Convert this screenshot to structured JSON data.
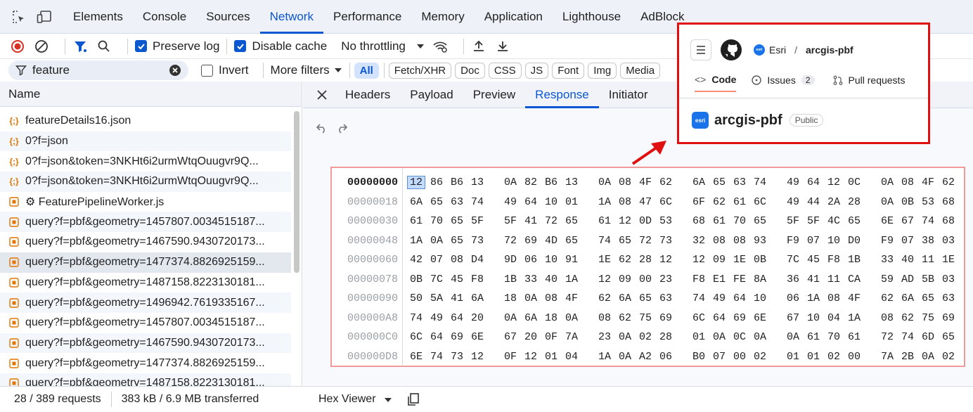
{
  "devtools": {
    "tabs": [
      "Elements",
      "Console",
      "Sources",
      "Network",
      "Performance",
      "Memory",
      "Application",
      "Lighthouse",
      "AdBlock"
    ],
    "active_tab": "Network"
  },
  "toolbar": {
    "preserve_log": "Preserve log",
    "disable_cache": "Disable cache",
    "throttling": "No throttling"
  },
  "filter": {
    "value": "feature",
    "invert": "Invert",
    "more_filters": "More filters",
    "chips": [
      "All",
      "Fetch/XHR",
      "Doc",
      "CSS",
      "JS",
      "Font",
      "Img",
      "Media"
    ]
  },
  "requests": {
    "header": "Name",
    "rows": [
      {
        "name": "featureDetails16.json",
        "type": "json"
      },
      {
        "name": "0?f=json",
        "type": "json"
      },
      {
        "name": "0?f=json&token=3NKHt6i2urmWtqOuugvr9Q...",
        "type": "json"
      },
      {
        "name": "0?f=json&token=3NKHt6i2urmWtqOuugvr9Q...",
        "type": "json"
      },
      {
        "name": "⚙ FeaturePipelineWorker.js",
        "type": "binary"
      },
      {
        "name": "query?f=pbf&geometry=1457807.0034515187...",
        "type": "binary"
      },
      {
        "name": "query?f=pbf&geometry=1467590.9430720173...",
        "type": "binary"
      },
      {
        "name": "query?f=pbf&geometry=1477374.8826925159...",
        "type": "binary"
      },
      {
        "name": "query?f=pbf&geometry=1487158.8223130181...",
        "type": "binary"
      },
      {
        "name": "query?f=pbf&geometry=1496942.7619335167...",
        "type": "binary"
      },
      {
        "name": "query?f=pbf&geometry=1457807.0034515187...",
        "type": "binary"
      },
      {
        "name": "query?f=pbf&geometry=1467590.9430720173...",
        "type": "binary"
      },
      {
        "name": "query?f=pbf&geometry=1477374.8826925159...",
        "type": "binary"
      },
      {
        "name": "query?f=pbf&geometry=1487158.8223130181...",
        "type": "binary"
      }
    ]
  },
  "detail_tabs": [
    "Headers",
    "Payload",
    "Preview",
    "Response",
    "Initiator"
  ],
  "active_detail_tab": "Response",
  "hex": {
    "rows": [
      {
        "addr": "00000000",
        "bytes": [
          "12",
          "86",
          "B6",
          "13",
          "0A",
          "82",
          "B6",
          "13",
          "0A",
          "08",
          "4F",
          "62",
          "6A",
          "65",
          "63",
          "74",
          "49",
          "64",
          "12",
          "0C",
          "0A",
          "08",
          "4F",
          "62"
        ]
      },
      {
        "addr": "00000018",
        "bytes": [
          "6A",
          "65",
          "63",
          "74",
          "49",
          "64",
          "10",
          "01",
          "1A",
          "08",
          "47",
          "6C",
          "6F",
          "62",
          "61",
          "6C",
          "49",
          "44",
          "2A",
          "28",
          "0A",
          "0B",
          "53",
          "68"
        ]
      },
      {
        "addr": "00000030",
        "bytes": [
          "61",
          "70",
          "65",
          "5F",
          "5F",
          "41",
          "72",
          "65",
          "61",
          "12",
          "0D",
          "53",
          "68",
          "61",
          "70",
          "65",
          "5F",
          "5F",
          "4C",
          "65",
          "6E",
          "67",
          "74",
          "68"
        ]
      },
      {
        "addr": "00000048",
        "bytes": [
          "1A",
          "0A",
          "65",
          "73",
          "72",
          "69",
          "4D",
          "65",
          "74",
          "65",
          "72",
          "73",
          "32",
          "08",
          "08",
          "93",
          "F9",
          "07",
          "10",
          "D0",
          "F9",
          "07",
          "38",
          "03"
        ]
      },
      {
        "addr": "00000060",
        "bytes": [
          "42",
          "07",
          "08",
          "D4",
          "9D",
          "06",
          "10",
          "91",
          "1E",
          "62",
          "28",
          "12",
          "12",
          "09",
          "1E",
          "0B",
          "7C",
          "45",
          "F8",
          "1B",
          "33",
          "40",
          "11",
          "1E"
        ]
      },
      {
        "addr": "00000078",
        "bytes": [
          "0B",
          "7C",
          "45",
          "F8",
          "1B",
          "33",
          "40",
          "1A",
          "12",
          "09",
          "00",
          "23",
          "F8",
          "E1",
          "FE",
          "8A",
          "36",
          "41",
          "11",
          "CA",
          "59",
          "AD",
          "5B",
          "03"
        ]
      },
      {
        "addr": "00000090",
        "bytes": [
          "50",
          "5A",
          "41",
          "6A",
          "18",
          "0A",
          "08",
          "4F",
          "62",
          "6A",
          "65",
          "63",
          "74",
          "49",
          "64",
          "10",
          "06",
          "1A",
          "08",
          "4F",
          "62",
          "6A",
          "65",
          "63"
        ]
      },
      {
        "addr": "000000A8",
        "bytes": [
          "74",
          "49",
          "64",
          "20",
          "0A",
          "6A",
          "18",
          "0A",
          "08",
          "62",
          "75",
          "69",
          "6C",
          "64",
          "69",
          "6E",
          "67",
          "10",
          "04",
          "1A",
          "08",
          "62",
          "75",
          "69"
        ]
      },
      {
        "addr": "000000C0",
        "bytes": [
          "6C",
          "64",
          "69",
          "6E",
          "67",
          "20",
          "0F",
          "7A",
          "23",
          "0A",
          "02",
          "28",
          "01",
          "0A",
          "0C",
          "0A",
          "0A",
          "61",
          "70",
          "61",
          "72",
          "74",
          "6D",
          "65"
        ]
      },
      {
        "addr": "000000D8",
        "bytes": [
          "6E",
          "74",
          "73",
          "12",
          "0F",
          "12",
          "01",
          "04",
          "1A",
          "0A",
          "A2",
          "06",
          "B0",
          "07",
          "00",
          "02",
          "01",
          "01",
          "02",
          "00",
          "7A",
          "2B",
          "0A",
          "02"
        ]
      }
    ]
  },
  "status": {
    "requests": "28 / 389 requests",
    "transferred": "383 kB / 6.9 MB transferred",
    "viewer": "Hex Viewer"
  },
  "github": {
    "owner": "Esri",
    "repo": "arcgis-pbf",
    "code_tab": "Code",
    "issues_tab": "Issues",
    "issues_count": "2",
    "pulls_tab": "Pull requests",
    "repo_title": "arcgis-pbf",
    "visibility": "Public",
    "owner_badge": "esri"
  },
  "colors": {
    "accent": "#0b57d0",
    "highlight_border": "#e01010",
    "hex_border": "#f29a9a"
  }
}
